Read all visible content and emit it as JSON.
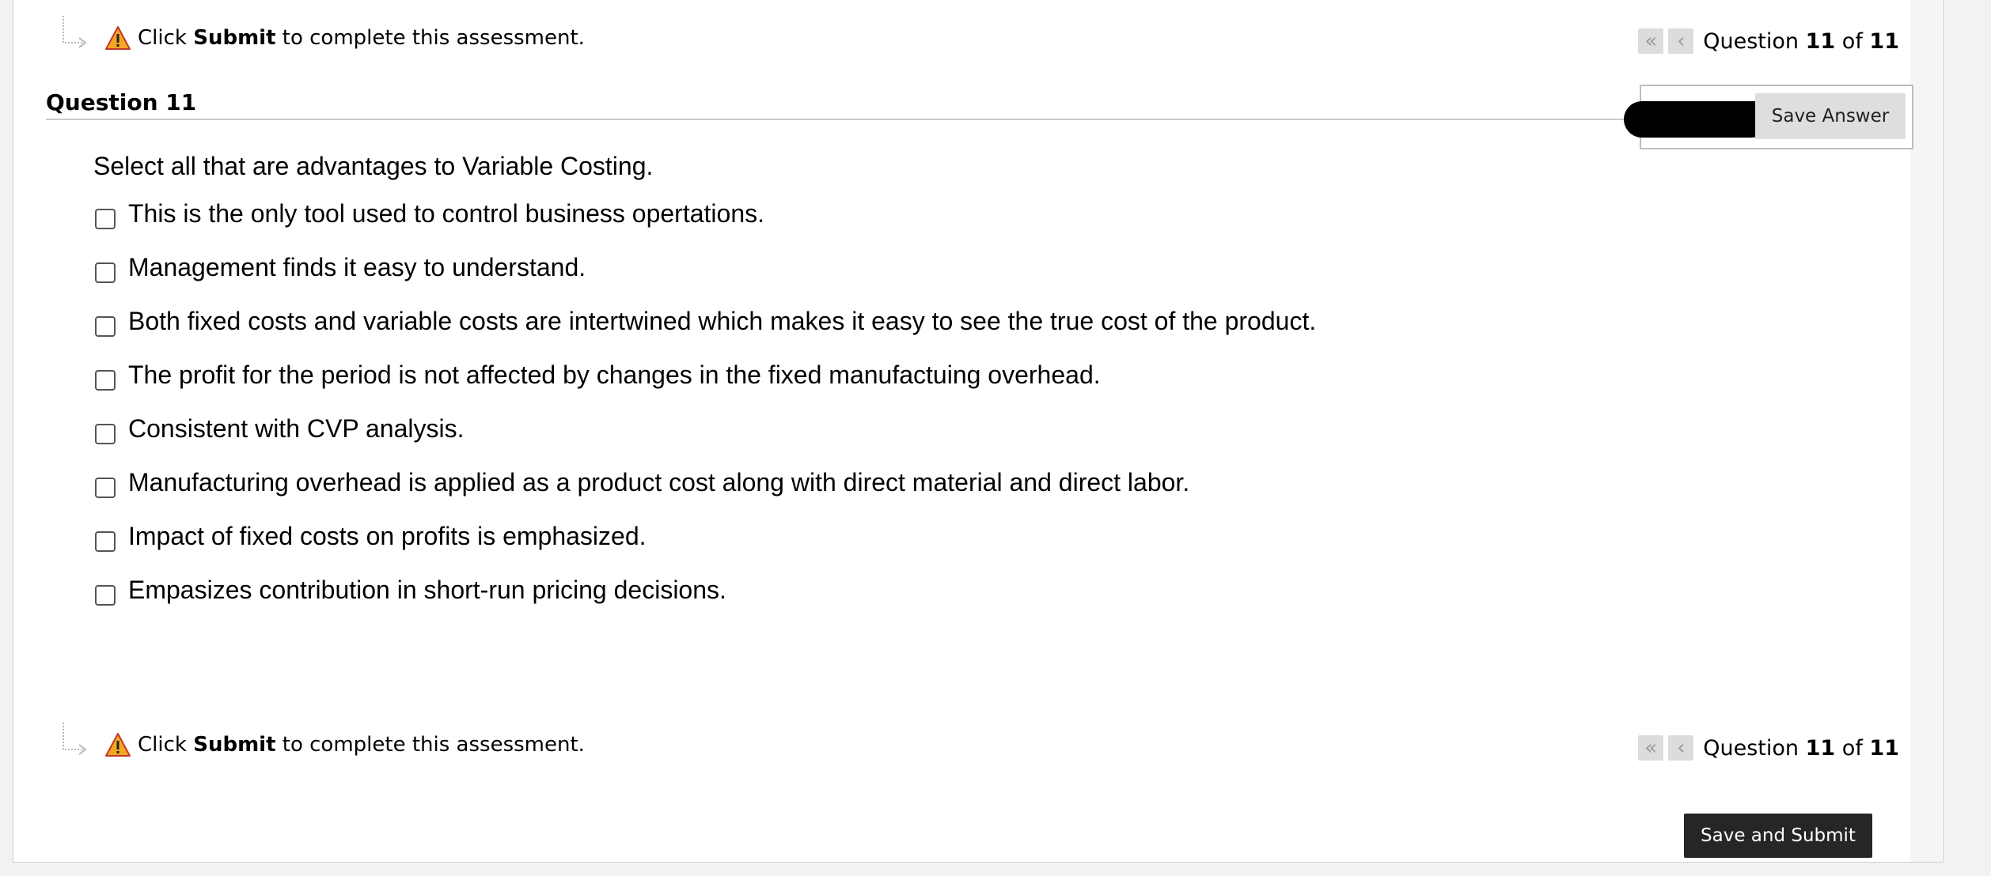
{
  "notice": {
    "prefix": "Click",
    "bold": "Submit",
    "suffix": "to complete this assessment."
  },
  "pager": {
    "label": "Question",
    "current": "11",
    "of": "of",
    "total": "11"
  },
  "question": {
    "title": "Question 11",
    "save_answer_label": "Save Answer",
    "prompt": "Select all that are advantages to Variable Costing.",
    "options": [
      "This is the only tool used to control business opertations.",
      "Management finds it easy to understand.",
      "Both fixed costs and variable costs are intertwined which makes it easy to see the true cost of the product.",
      "The profit for the period is not affected by changes in the fixed manufactuing overhead.",
      "Consistent with CVP analysis.",
      "Manufacturing overhead is applied as a product cost along with direct material and direct labor.",
      "Impact of fixed costs on profits is emphasized.",
      "Empasizes contribution in short-run pricing decisions."
    ]
  },
  "footer": {
    "submit_label": "Save and Submit"
  },
  "colors": {
    "warning_fill": "#f5a623",
    "submit_bg": "#262626",
    "pager_btn_bg": "#dcdcdc"
  },
  "icons": {
    "warning": "warning-triangle-icon",
    "first": "double-chevron-left-icon",
    "prev": "chevron-left-icon",
    "hook": "hook-arrow-icon"
  }
}
